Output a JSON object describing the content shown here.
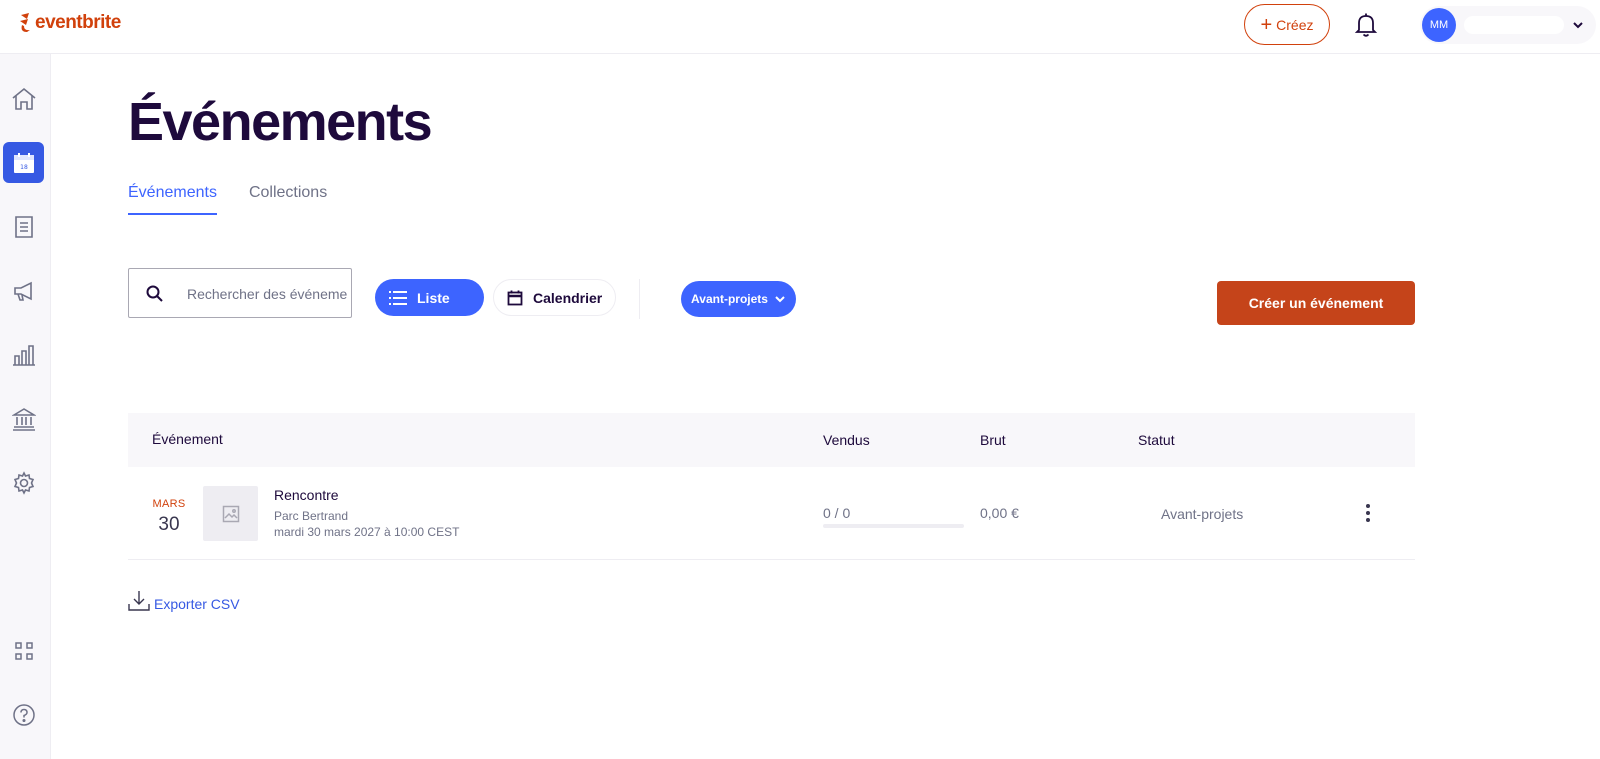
{
  "header": {
    "logo_text": "eventbrite",
    "create_label": "Créez",
    "avatar_initials": "MM",
    "brand_color": "#d1410c",
    "accent_color": "#3d64ff"
  },
  "sidebar": {
    "items": [
      {
        "name": "home",
        "icon": "home-icon",
        "active": false
      },
      {
        "name": "events",
        "icon": "calendar-icon",
        "active": true
      },
      {
        "name": "orders",
        "icon": "receipt-icon",
        "active": false
      },
      {
        "name": "marketing",
        "icon": "megaphone-icon",
        "active": false
      },
      {
        "name": "reports",
        "icon": "bar-chart-icon",
        "active": false
      },
      {
        "name": "finance",
        "icon": "bank-icon",
        "active": false
      },
      {
        "name": "settings",
        "icon": "gear-icon",
        "active": false
      },
      {
        "name": "apps",
        "icon": "grid-icon",
        "active": false
      },
      {
        "name": "help",
        "icon": "help-icon",
        "active": false
      }
    ]
  },
  "page": {
    "title": "Événements",
    "tabs": [
      {
        "label": "Événements",
        "active": true
      },
      {
        "label": "Collections",
        "active": false
      }
    ]
  },
  "toolbar": {
    "search_placeholder": "Rechercher des événements",
    "list_label": "Liste",
    "calendar_label": "Calendrier",
    "filter_label": "Avant-projets",
    "create_event_label": "Créer un événement"
  },
  "table": {
    "headers": {
      "event": "Événement",
      "sold": "Vendus",
      "gross": "Brut",
      "status": "Statut"
    },
    "rows": [
      {
        "month": "MARS",
        "day": "30",
        "title": "Rencontre",
        "venue": "Parc Bertrand",
        "datetime": "mardi 30 mars 2027 à 10:00 CEST",
        "sold": "0 / 0",
        "sold_fraction": 0,
        "gross": "0,00 €",
        "status": "Avant-projets"
      }
    ]
  },
  "export_label": "Exporter CSV"
}
